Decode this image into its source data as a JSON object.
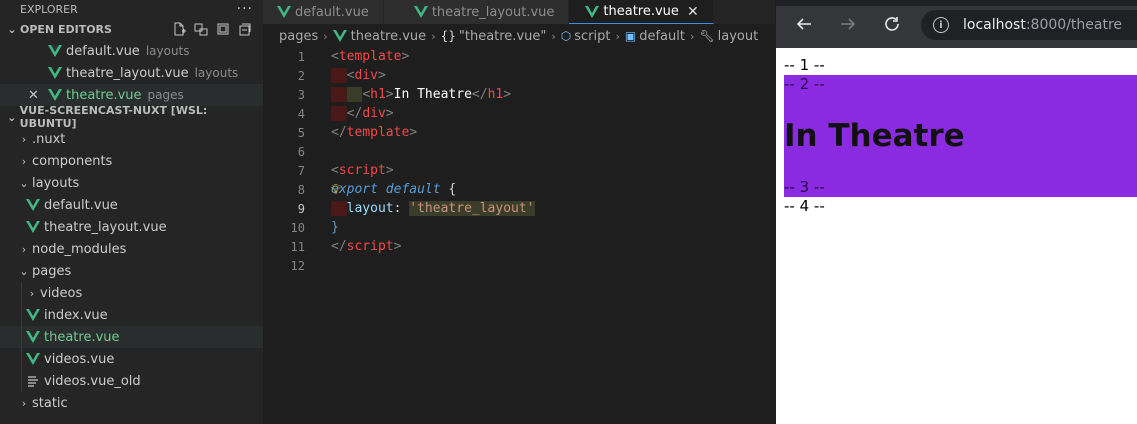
{
  "explorer": {
    "title": "EXPLORER",
    "more": "···",
    "open_editors": {
      "label": "OPEN EDITORS",
      "items": [
        {
          "name": "default.vue",
          "desc": "layouts"
        },
        {
          "name": "theatre_layout.vue",
          "desc": "layouts"
        },
        {
          "name": "theatre.vue",
          "desc": "pages"
        }
      ]
    },
    "workspace": {
      "label": "VUE-SCREENCAST-NUXT [WSL: UBUNTU]",
      "tree": [
        {
          "name": ".nuxt"
        },
        {
          "name": "components"
        },
        {
          "name": "layouts"
        },
        {
          "name": "default.vue"
        },
        {
          "name": "theatre_layout.vue"
        },
        {
          "name": "node_modules"
        },
        {
          "name": "pages"
        },
        {
          "name": "videos"
        },
        {
          "name": "index.vue"
        },
        {
          "name": "theatre.vue"
        },
        {
          "name": "videos.vue"
        },
        {
          "name": "videos.vue_old"
        },
        {
          "name": "static"
        }
      ]
    }
  },
  "editor": {
    "tabs": [
      {
        "label": "default.vue"
      },
      {
        "label": "theatre_layout.vue"
      },
      {
        "label": "theatre.vue",
        "close": "✕"
      }
    ],
    "breadcrumb": [
      "pages",
      "theatre.vue",
      "\"theatre.vue\"",
      "script",
      "default",
      "layout"
    ],
    "line_numbers": [
      "1",
      "2",
      "3",
      "4",
      "5",
      "6",
      "7",
      "8",
      "9",
      "10",
      "11",
      "12"
    ],
    "code": {
      "l1_open": "<",
      "l1_tag": "template",
      "l1_close": ">",
      "l2_tag": "div",
      "l3_tag": "h1",
      "l3_text": "In Theatre",
      "l3_end": "h1",
      "l4_tag": "div",
      "l5_tag": "template",
      "l7_tag": "script",
      "l8_kw1": "ex",
      "l8_kw2": "port default",
      "l8_brace": " {",
      "l9_prop": "layout",
      "l9_colon": ": ",
      "l9_str": "'theatre_layout'",
      "l10": "}",
      "l11_tag": "script"
    }
  },
  "browser": {
    "url_host": "localhost",
    "url_path": ":8000/theatre",
    "page": {
      "m1": "-- 1 --",
      "m2": "-- 2 --",
      "heading": "In Theatre",
      "m3": "-- 3 --",
      "m4": "-- 4 --"
    },
    "accent": "#8a2be2"
  }
}
